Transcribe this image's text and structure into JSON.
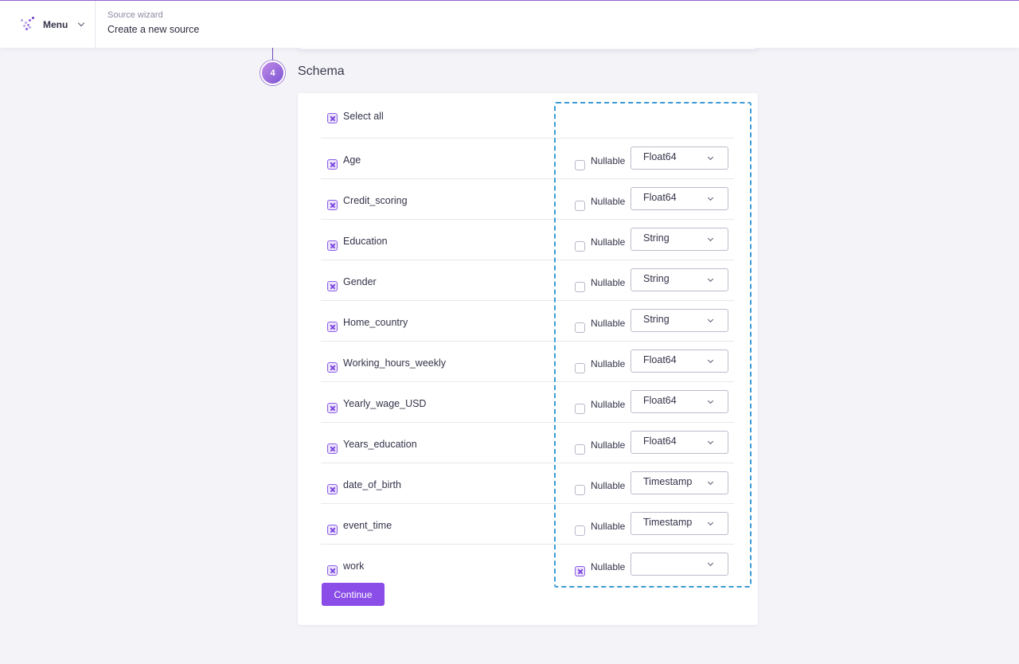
{
  "header": {
    "menu_label": "Menu",
    "breadcrumb_sub": "Source wizard",
    "breadcrumb_title": "Create a new source"
  },
  "step": {
    "number": "4",
    "title": "Schema"
  },
  "schema": {
    "select_all_label": "Select all",
    "nullable_label": "Nullable",
    "fields": [
      {
        "name": "Age",
        "selected": true,
        "nullable": false,
        "type": "Float64"
      },
      {
        "name": "Credit_scoring",
        "selected": true,
        "nullable": false,
        "type": "Float64"
      },
      {
        "name": "Education",
        "selected": true,
        "nullable": false,
        "type": "String"
      },
      {
        "name": "Gender",
        "selected": true,
        "nullable": false,
        "type": "String"
      },
      {
        "name": "Home_country",
        "selected": true,
        "nullable": false,
        "type": "String"
      },
      {
        "name": "Working_hours_weekly",
        "selected": true,
        "nullable": false,
        "type": "Float64"
      },
      {
        "name": "Yearly_wage_USD",
        "selected": true,
        "nullable": false,
        "type": "Float64"
      },
      {
        "name": "Years_education",
        "selected": true,
        "nullable": false,
        "type": "Float64"
      },
      {
        "name": "date_of_birth",
        "selected": true,
        "nullable": false,
        "type": "Timestamp"
      },
      {
        "name": "event_time",
        "selected": true,
        "nullable": false,
        "type": "Timestamp"
      },
      {
        "name": "work",
        "selected": true,
        "nullable": true,
        "type": ""
      }
    ]
  },
  "actions": {
    "continue_label": "Continue"
  },
  "colors": {
    "accent": "#8a4de8",
    "checkbox_border": "#8b5ce6",
    "highlight_dash": "#3b9ad4"
  }
}
